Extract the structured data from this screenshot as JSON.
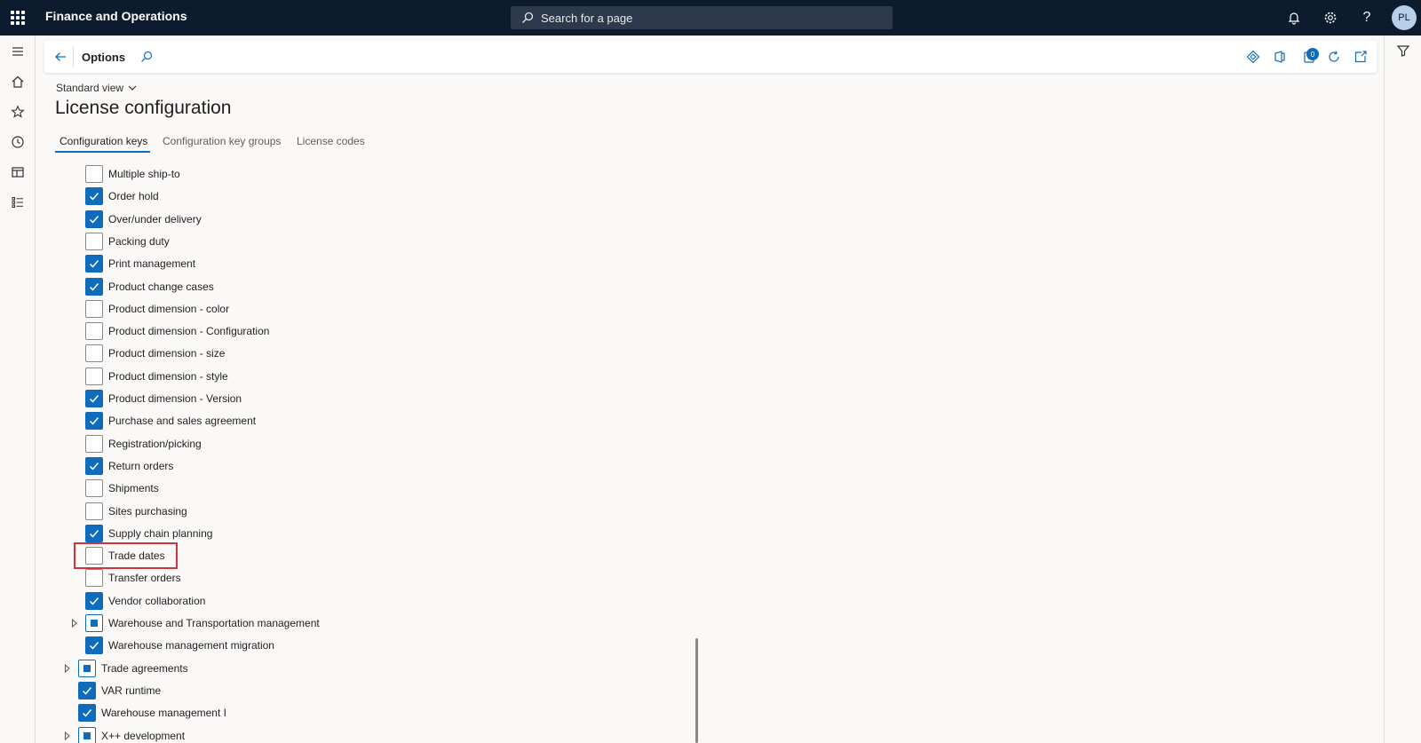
{
  "app": {
    "title": "Finance and Operations"
  },
  "search": {
    "placeholder": "Search for a page"
  },
  "user": {
    "initials": "PL"
  },
  "actionpane": {
    "title": "Options",
    "notification_count": "0"
  },
  "header": {
    "view": "Standard view",
    "title": "License configuration"
  },
  "tabs": [
    {
      "label": "Configuration keys"
    },
    {
      "label": "Configuration key groups"
    },
    {
      "label": "License codes"
    }
  ],
  "tree": [
    {
      "label": "Multiple ship-to",
      "state": "unchecked"
    },
    {
      "label": "Order hold",
      "state": "checked"
    },
    {
      "label": "Over/under delivery",
      "state": "checked"
    },
    {
      "label": "Packing duty",
      "state": "unchecked"
    },
    {
      "label": "Print management",
      "state": "checked"
    },
    {
      "label": "Product change cases",
      "state": "checked"
    },
    {
      "label": "Product dimension - color",
      "state": "unchecked"
    },
    {
      "label": "Product dimension - Configuration",
      "state": "unchecked"
    },
    {
      "label": "Product dimension - size",
      "state": "unchecked"
    },
    {
      "label": "Product dimension - style",
      "state": "unchecked"
    },
    {
      "label": "Product dimension - Version",
      "state": "checked"
    },
    {
      "label": "Purchase and sales agreement",
      "state": "checked"
    },
    {
      "label": "Registration/picking",
      "state": "unchecked"
    },
    {
      "label": "Return orders",
      "state": "checked"
    },
    {
      "label": "Shipments",
      "state": "unchecked"
    },
    {
      "label": "Sites purchasing",
      "state": "unchecked"
    },
    {
      "label": "Supply chain planning",
      "state": "checked"
    },
    {
      "label": "Trade dates",
      "state": "unchecked"
    },
    {
      "label": "Transfer orders",
      "state": "unchecked"
    },
    {
      "label": "Vendor collaboration",
      "state": "checked"
    },
    {
      "label": "Warehouse and Transportation management",
      "state": "partial"
    },
    {
      "label": "Warehouse management migration",
      "state": "checked"
    },
    {
      "label": "Trade agreements",
      "state": "partial"
    },
    {
      "label": "VAR runtime",
      "state": "checked"
    },
    {
      "label": "Warehouse management I",
      "state": "checked"
    },
    {
      "label": "X++ development",
      "state": "partial"
    }
  ],
  "colors": {
    "accent": "#0f6cbd",
    "topbar": "#0d1b2e",
    "highlight": "#d13438"
  }
}
